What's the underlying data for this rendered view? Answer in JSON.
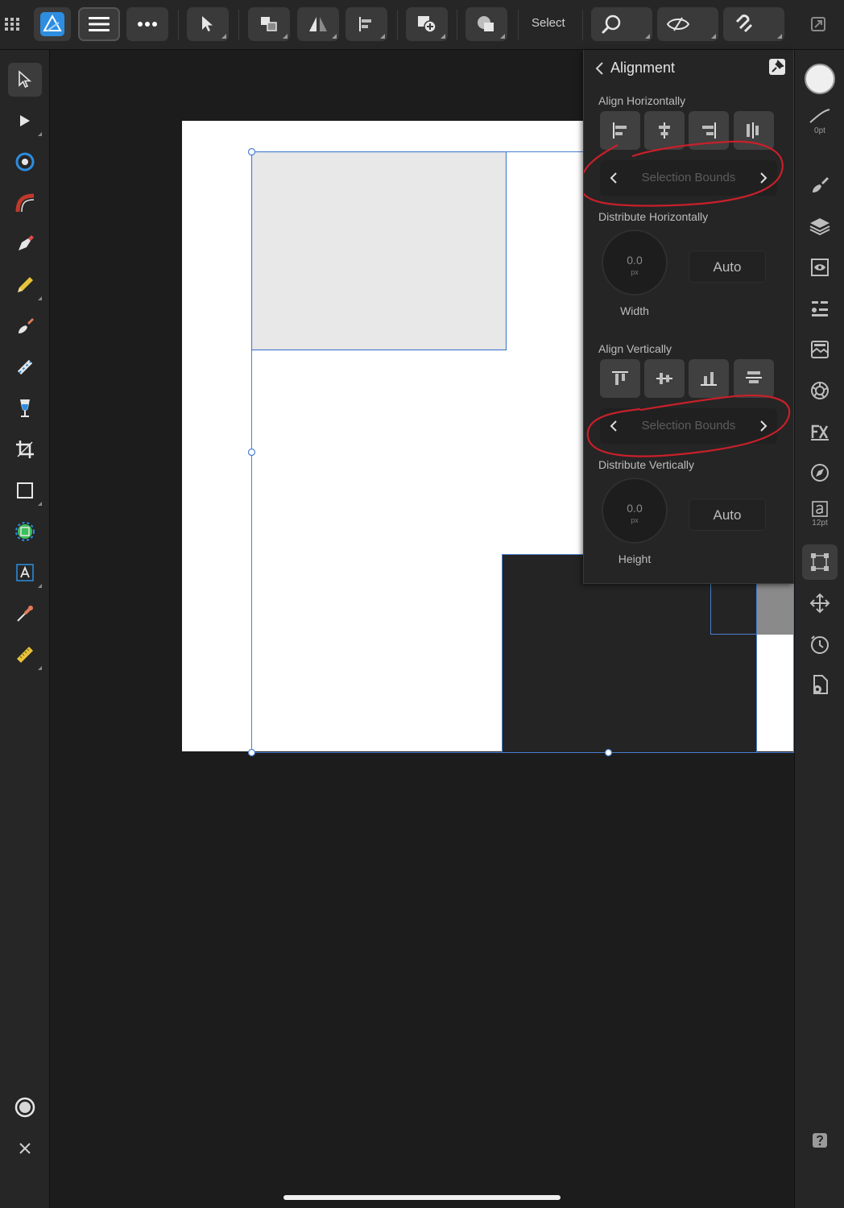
{
  "toolbar": {
    "select_label": "Select"
  },
  "panel": {
    "title": "Alignment",
    "align_horizontally_label": "Align Horizontally",
    "distribute_horizontally_label": "Distribute Horizontally",
    "align_vertically_label": "Align Vertically",
    "distribute_vertically_label": "Distribute Vertically",
    "horizontal_bounds": "Selection Bounds",
    "vertical_bounds": "Selection Bounds",
    "width_value": "0.0",
    "width_unit": "px",
    "width_caption": "Width",
    "height_value": "0.0",
    "height_unit": "px",
    "height_caption": "Height",
    "auto_h": "Auto",
    "auto_v": "Auto"
  },
  "studio": {
    "stroke_width": "0pt",
    "text_size": "12pt"
  },
  "colors": {
    "selection": "#4a7fd0",
    "annotation": "#c8202a",
    "accent": "#2d8de0"
  }
}
